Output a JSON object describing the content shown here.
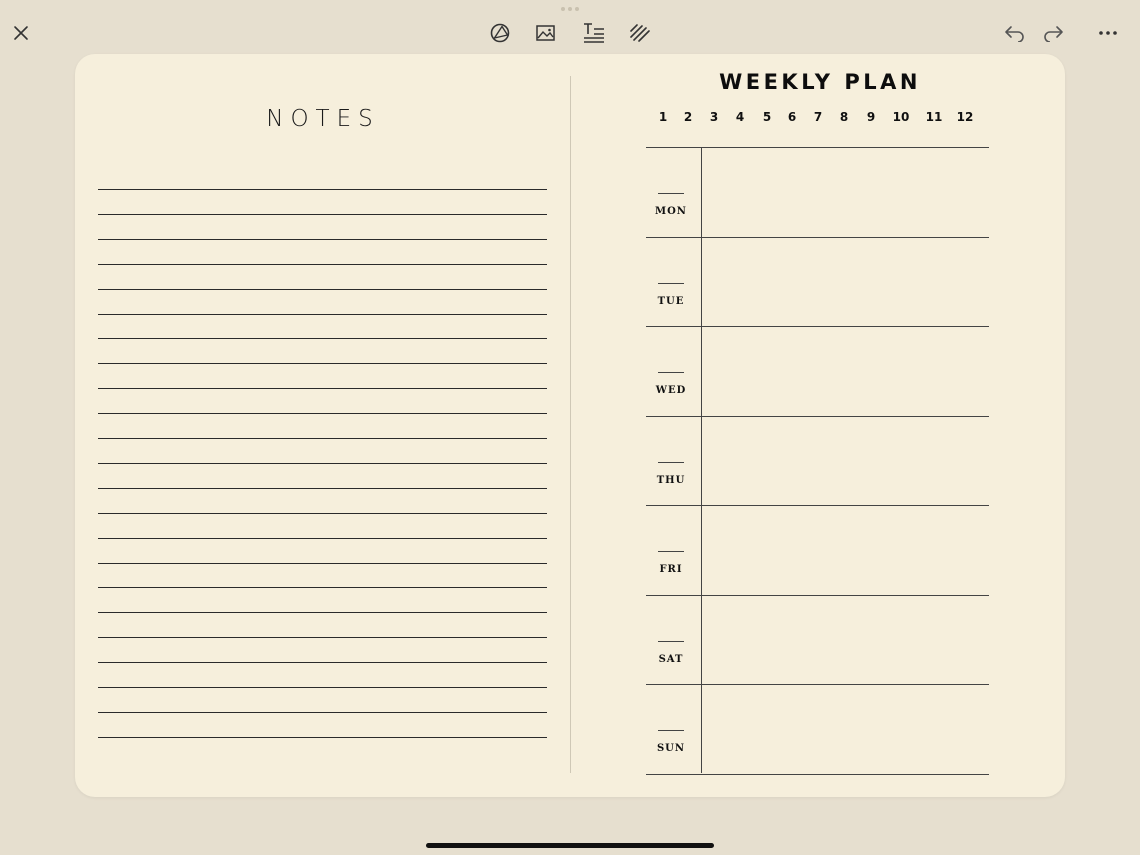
{
  "toolbar": {
    "icons": [
      "close-icon",
      "shape-icon",
      "image-icon",
      "text-icon",
      "pen-icon",
      "undo-icon",
      "redo-icon",
      "more-icon"
    ]
  },
  "notes": {
    "title": "NOTES",
    "line_count": 23
  },
  "weekly_plan": {
    "title": "WEEKLY PLAN",
    "hours": [
      "1",
      "2",
      "3",
      "4",
      "5",
      "6",
      "7",
      "8",
      "9",
      "10",
      "11",
      "12"
    ],
    "days": [
      "MON",
      "TUE",
      "WED",
      "THU",
      "FRI",
      "SAT",
      "SUN"
    ]
  },
  "colors": {
    "background": "#e6dfcf",
    "paper": "#f6efdc",
    "ink": "#111111"
  }
}
